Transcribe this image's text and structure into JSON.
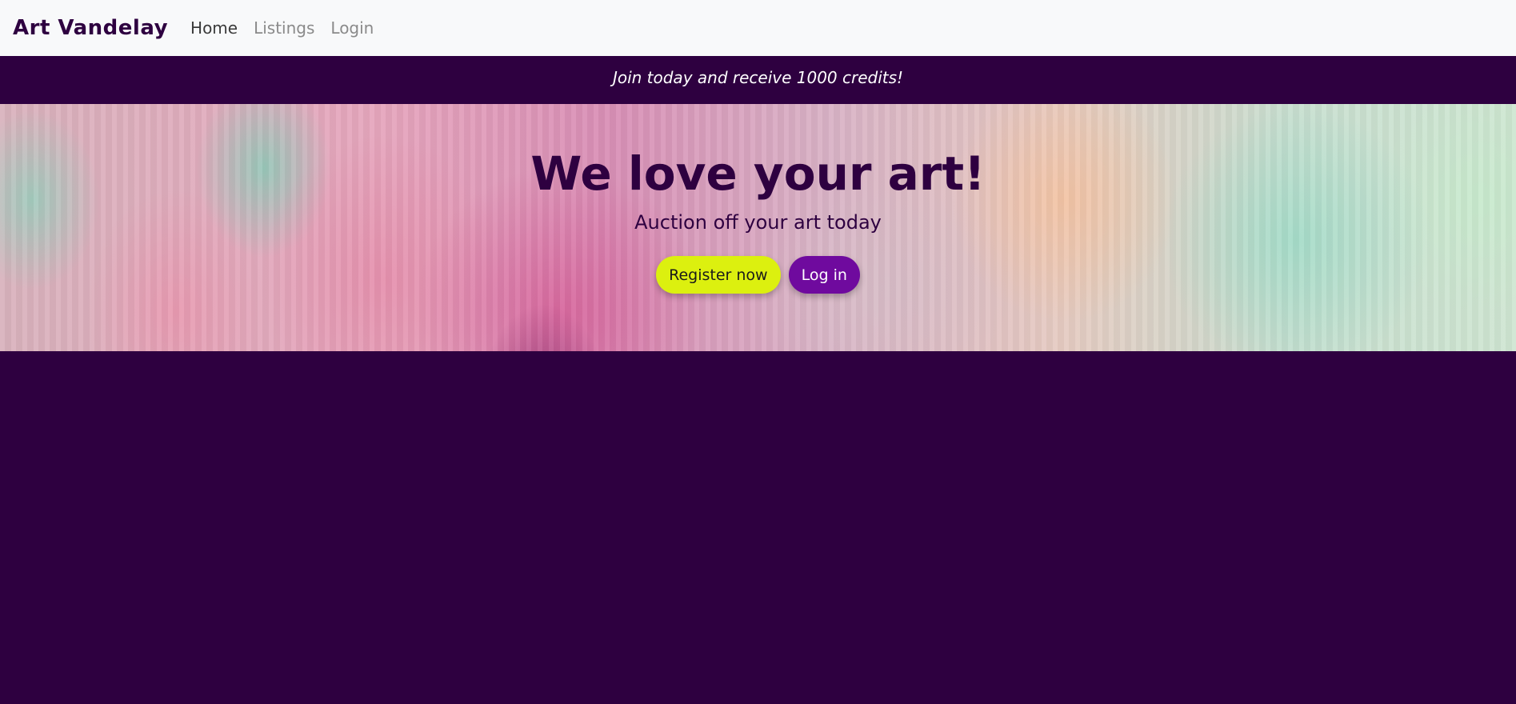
{
  "navbar": {
    "brand": "Art Vandelay",
    "links": [
      {
        "label": "Home",
        "active": true
      },
      {
        "label": "Listings",
        "active": false
      },
      {
        "label": "Login",
        "active": false
      }
    ]
  },
  "announcement": "Join today and receive 1000 credits!",
  "hero": {
    "title": "We love your art!",
    "subtitle": "Auction off your art today",
    "register_label": "Register now",
    "login_label": "Log in"
  },
  "colors": {
    "primary_dark": "#2e0040",
    "accent_yellow": "#dcf00f",
    "accent_purple": "#6f0a9e",
    "navbar_bg": "#f8f9fa"
  }
}
